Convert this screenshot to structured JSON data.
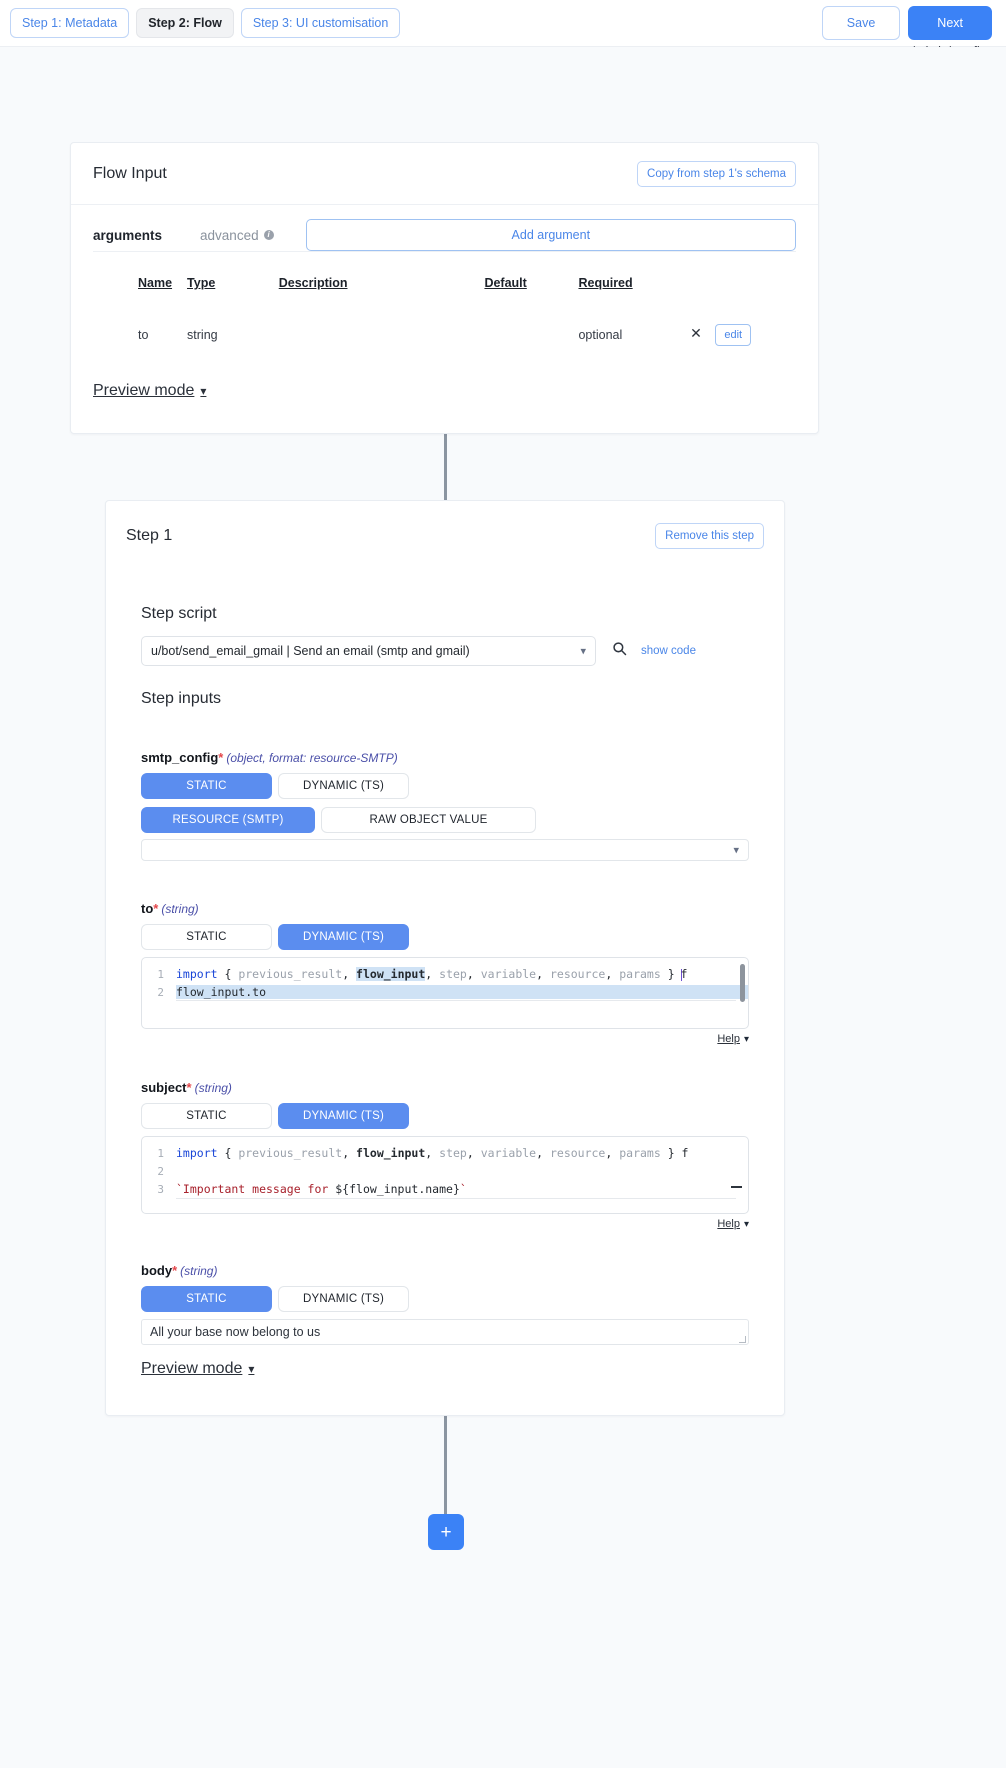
{
  "topbar": {
    "steps": [
      {
        "label": "Step 1: Metadata",
        "active": false
      },
      {
        "label": "Step 2: Flow",
        "active": true
      },
      {
        "label": "Step 3: UI customisation",
        "active": false
      }
    ],
    "save_label": "Save",
    "next_label": "Next",
    "path": "u/admin/my_flow"
  },
  "flow_input": {
    "title": "Flow Input",
    "copy_button": "Copy from step 1's schema",
    "tab_arguments": "arguments",
    "tab_advanced": "advanced",
    "info_icon": "info-icon",
    "add_argument": "Add argument",
    "columns": [
      "Name",
      "Type",
      "Description",
      "Default",
      "Required"
    ],
    "rows": [
      {
        "name": "to",
        "type": "string",
        "description": "",
        "default": "",
        "required": "optional",
        "remove_label": "✕",
        "edit_label": "edit"
      }
    ],
    "preview_mode": "Preview mode",
    "chevron": "⌄"
  },
  "step1": {
    "title": "Step 1",
    "remove_label": "Remove this step",
    "step_script_heading": "Step script",
    "script_value": "u/bot/send_email_gmail | Send an email (smtp and gmail)",
    "search_icon": "search-icon",
    "show_code": "show code",
    "step_inputs_heading": "Step inputs",
    "preview_mode": "Preview mode",
    "chevron": "⌄",
    "help_label": "Help",
    "inputs": [
      {
        "name": "smtp_config",
        "required_mark": "*",
        "type_hint": "(object, format: resource-SMTP)",
        "mode_static": "STATIC",
        "mode_dynamic": "DYNAMIC (TS)",
        "mode_selected": "STATIC",
        "sub_modes": {
          "resource": "RESOURCE (SMTP)",
          "raw": "RAW OBJECT VALUE",
          "selected": "RESOURCE (SMTP)"
        },
        "value": ""
      },
      {
        "name": "to",
        "required_mark": "*",
        "type_hint": "(string)",
        "mode_static": "STATIC",
        "mode_dynamic": "DYNAMIC (TS)",
        "mode_selected": "DYNAMIC (TS)",
        "code": {
          "line1_kw": "import",
          "line1_rest": " { previous_result, flow_input, step, variable, resource, params } f",
          "line2": "flow_input.to",
          "line_numbers": [
            "1",
            "2"
          ]
        }
      },
      {
        "name": "subject",
        "required_mark": "*",
        "type_hint": "(string)",
        "mode_static": "STATIC",
        "mode_dynamic": "DYNAMIC (TS)",
        "mode_selected": "DYNAMIC (TS)",
        "code": {
          "line1_kw": "import",
          "line1_rest": " { previous_result, flow_input, step, variable, resource, params } f",
          "line2": "",
          "line3": "`Important message for ${flow_input.name}`",
          "line_numbers": [
            "1",
            "2",
            "3"
          ]
        }
      },
      {
        "name": "body",
        "required_mark": "*",
        "type_hint": "(string)",
        "mode_static": "STATIC",
        "mode_dynamic": "DYNAMIC (TS)",
        "mode_selected": "STATIC",
        "value": "All your base now belong to us"
      }
    ]
  },
  "add_step": {
    "label": "+"
  }
}
